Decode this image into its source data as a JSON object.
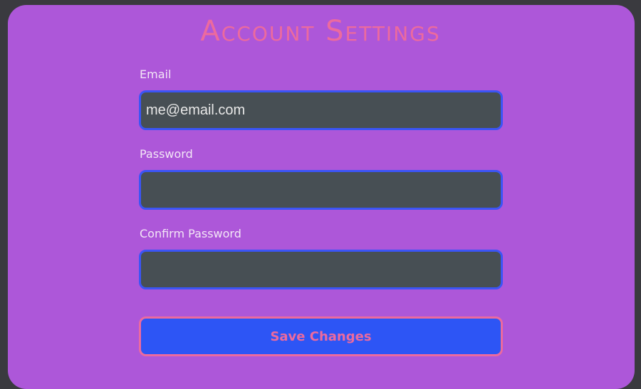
{
  "form": {
    "title": "Account Settings",
    "email": {
      "label": "Email",
      "value": "me@email.com"
    },
    "password": {
      "label": "Password",
      "value": ""
    },
    "confirm_password": {
      "label": "Confirm Password",
      "value": ""
    },
    "save_label": "Save Changes"
  },
  "colors": {
    "background": "#3a3a3f",
    "card": "#ad57d9",
    "title": "#ec6a9e",
    "input_bg": "#474f54",
    "input_border": "#3b55f5",
    "button_bg": "#2d55f5",
    "button_border": "#ec6a9e"
  }
}
